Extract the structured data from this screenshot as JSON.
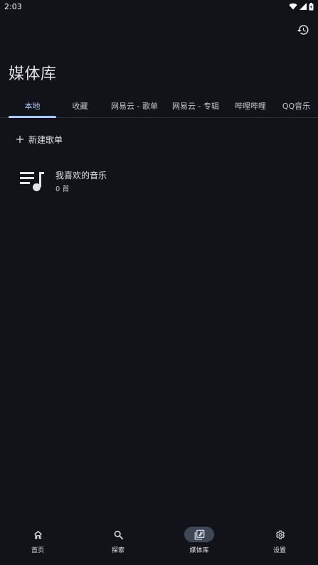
{
  "status_bar": {
    "time": "2:03",
    "icons": [
      "wifi-icon",
      "signal-icon",
      "battery-icon"
    ]
  },
  "top_bar": {
    "history_icon": "history-icon"
  },
  "page": {
    "title": "媒体库"
  },
  "tabs": {
    "active_index": 0,
    "items": [
      {
        "label": "本地"
      },
      {
        "label": "收藏"
      },
      {
        "label": "网易云 - 歌单"
      },
      {
        "label": "网易云 - 专辑"
      },
      {
        "label": "哔哩哔哩"
      },
      {
        "label": "QQ音乐"
      }
    ]
  },
  "actions": {
    "new_playlist_label": "新建歌单",
    "new_playlist_icon": "plus-icon"
  },
  "playlists": [
    {
      "name": "我喜欢的音乐",
      "count": "0 首",
      "icon": "playlist-music-icon"
    }
  ],
  "bottom_nav": {
    "active_index": 2,
    "items": [
      {
        "label": "首页",
        "icon": "home-icon"
      },
      {
        "label": "探索",
        "icon": "search-icon"
      },
      {
        "label": "媒体库",
        "icon": "library-music-icon"
      },
      {
        "label": "设置",
        "icon": "gear-icon"
      }
    ]
  },
  "colors": {
    "background": "#111318",
    "accent": "#a8c7fa",
    "active_nav_pill": "#3d4758",
    "text_primary": "#e3e2e6",
    "text_secondary": "#c4c6d0"
  }
}
